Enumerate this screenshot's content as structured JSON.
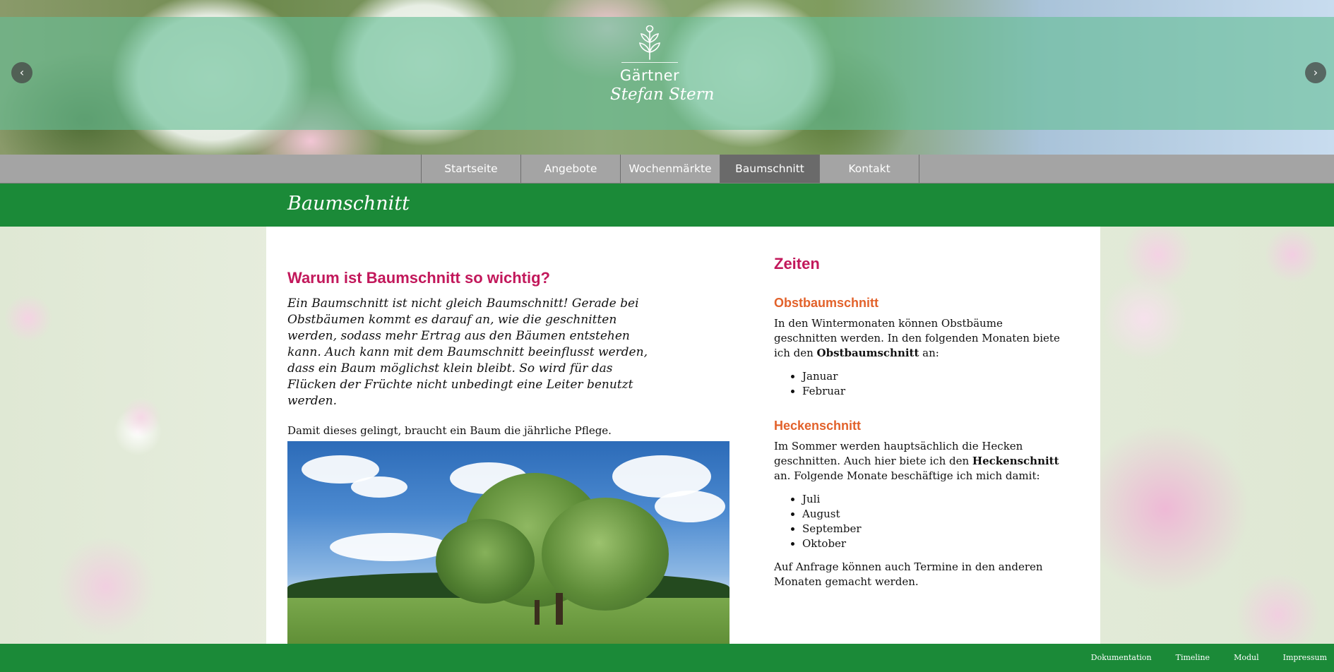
{
  "hero": {
    "logo_title": "Gärtner",
    "logo_subtitle": "Stefan Stern",
    "logo_icon": "sprout-icon",
    "prev_icon": "chevron-left-icon",
    "next_icon": "chevron-right-icon",
    "prev_glyph": "‹",
    "next_glyph": "›"
  },
  "nav": {
    "items": [
      {
        "label": "Startseite"
      },
      {
        "label": "Angebote"
      },
      {
        "label": "Wochenmärkte"
      },
      {
        "label": "Baumschnitt"
      },
      {
        "label": "Kontakt"
      }
    ],
    "active": "Baumschnitt"
  },
  "page_title": "Baumschnitt",
  "left": {
    "heading": "Warum ist Baumschnitt so wichtig?",
    "lead": "Ein Baumschnitt ist nicht gleich Baumschnitt! Gerade bei Obstbäumen kommt es darauf an, wie die geschnitten werden, sodass mehr Ertrag aus den Bäumen entstehen kann. Auch kann mit dem Baumschnitt beeinflusst werden, dass ein Baum möglichst klein bleibt. So wird für das Flücken der Früchte nicht unbedingt eine Leiter benutzt werden.",
    "paragraph": "Damit dieses gelingt, braucht ein Baum die jährliche Pflege."
  },
  "right": {
    "heading": "Zeiten",
    "obst": {
      "heading": "Obstbaumschnitt",
      "text_before": "In den Wintermonaten können Obstbäume geschnitten werden. In den folgenden Monaten biete ich den ",
      "bold": "Obstbaumschnitt",
      "text_after": " an:",
      "months": [
        "Januar",
        "Februar"
      ]
    },
    "hecke": {
      "heading": "Heckenschnitt",
      "text_before": "Im Sommer werden hauptsächlich die Hecken geschnitten. Auch hier biete ich den ",
      "bold": "Heckenschnitt",
      "text_after": " an. Folgende Monate beschäftige ich mich damit:",
      "months": [
        "Juli",
        "August",
        "September",
        "Oktober"
      ]
    },
    "closing": "Auf Anfrage können auch Termine in den anderen Monaten gemacht werden."
  },
  "footer": {
    "links": [
      "Dokumentation",
      "Timeline",
      "Modul",
      "Impressum"
    ]
  },
  "colors": {
    "green": "#1b8a38",
    "nav_gray": "#a4a4a4",
    "nav_active": "#6a6a6a",
    "heading_magenta": "#c2185b",
    "subheading_orange": "#e2622b"
  }
}
